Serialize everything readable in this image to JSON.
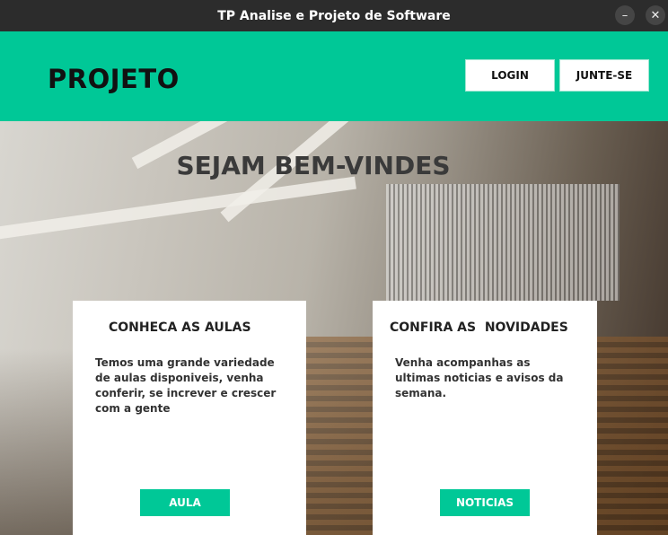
{
  "window": {
    "title": "TP Analise e Projeto de Software",
    "minimize_glyph": "–",
    "close_glyph": "✕"
  },
  "header": {
    "brand": "PROJETO",
    "login_label": "LOGIN",
    "join_label": "JUNTE-SE"
  },
  "hero": {
    "welcome": "SEJAM BEM-VINDES"
  },
  "cards": [
    {
      "title": "CONHECA AS AULAS",
      "text": "Temos uma grande variedade de aulas disponiveis, venha conferir, se increver e crescer com a gente",
      "button": "AULA"
    },
    {
      "title": "CONFIRA AS  NOVIDADES",
      "text": "Venha acompanhas as ultimas noticias e avisos da semana.",
      "button": "NOTICIAS"
    }
  ],
  "colors": {
    "accent": "#00c897",
    "titlebar": "#2c2c2c"
  }
}
